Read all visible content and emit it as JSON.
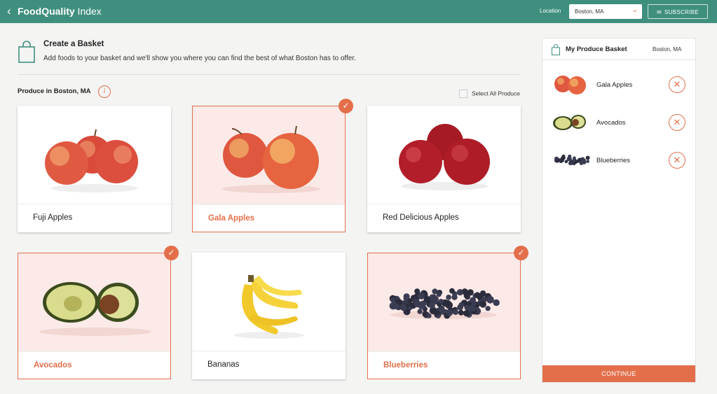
{
  "header": {
    "back_icon": "chevron-left-icon",
    "brand_bold": "FoodQuality",
    "brand_rest": " Index",
    "location_label": "Location",
    "location_value": "Boston, MA",
    "subscribe_label": "SUBSCRIBE"
  },
  "intro": {
    "title": "Create a Basket",
    "text": "Add foods to your basket and we'll show you where you can find the best of what Boston has to offer."
  },
  "produce": {
    "heading": "Produce in Boston, MA",
    "info_glyph": "i",
    "select_all_label": "Select All Produce",
    "items": [
      {
        "name": "Fuji Apples",
        "selected": false
      },
      {
        "name": "Gala Apples",
        "selected": true
      },
      {
        "name": "Red Delicious Apples",
        "selected": false
      },
      {
        "name": "Avocados",
        "selected": true
      },
      {
        "name": "Bananas",
        "selected": false
      },
      {
        "name": "Blueberries",
        "selected": true
      }
    ]
  },
  "basket": {
    "title": "My Produce Basket",
    "location": "Boston, MA",
    "items": [
      {
        "label": "Gala Apples"
      },
      {
        "label": "Avocados"
      },
      {
        "label": "Blueberries"
      }
    ],
    "continue_label": "CONTINUE"
  },
  "colors": {
    "brand_green": "#3f8f7e",
    "accent_orange": "#e36f4a",
    "selected_bg": "#fbeae8"
  }
}
